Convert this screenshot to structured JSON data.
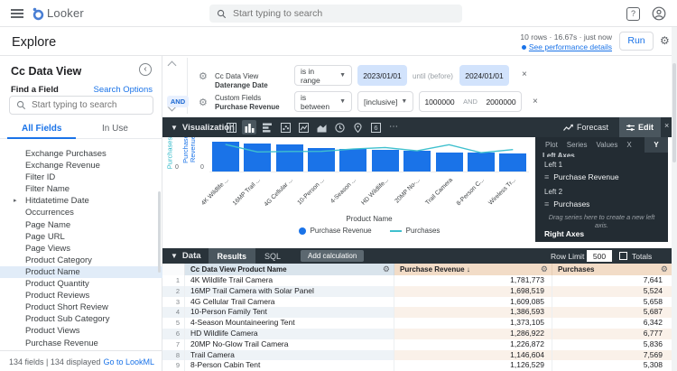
{
  "header": {
    "app_name": "Looker",
    "search_placeholder": "Start typing to search"
  },
  "explore": {
    "title": "Explore",
    "status": "10 rows · 16.67s · just now",
    "perf_link": "See performance details",
    "run_label": "Run"
  },
  "sidebar": {
    "title": "Cc Data View",
    "find_label": "Find a Field",
    "search_options": "Search Options",
    "search_placeholder": "Start typing to search",
    "tabs": [
      "All Fields",
      "In Use"
    ],
    "active_tab": "All Fields",
    "fields": [
      {
        "label": "Exchange Purchases"
      },
      {
        "label": "Exchange Revenue"
      },
      {
        "label": "Filter ID"
      },
      {
        "label": "Filter Name"
      },
      {
        "label": "Hitdatetime Date",
        "expandable": true
      },
      {
        "label": "Occurrences"
      },
      {
        "label": "Page Name"
      },
      {
        "label": "Page URL"
      },
      {
        "label": "Page Views"
      },
      {
        "label": "Product Category"
      },
      {
        "label": "Product Name",
        "selected": true
      },
      {
        "label": "Product Quantity"
      },
      {
        "label": "Product Reviews"
      },
      {
        "label": "Product Short Review"
      },
      {
        "label": "Product Sub Category"
      },
      {
        "label": "Product Views"
      },
      {
        "label": "Purchase Revenue"
      }
    ],
    "footer_text": "134 fields | 134 displayed",
    "footer_link": "Go to LookML"
  },
  "filters": {
    "operator": "AND",
    "rows": [
      {
        "field_group": "Cc Data View",
        "field_name": "Daterange Date",
        "condition": "is in range",
        "value1": "2023/01/01",
        "middle": "until (before)",
        "value2": "2024/01/01"
      },
      {
        "field_group": "Custom Fields",
        "field_name": "Purchase Revenue",
        "condition": "is between",
        "qualifier": "[inclusive]",
        "value1": "1000000",
        "middle": "AND",
        "value2": "2000000"
      }
    ]
  },
  "viz": {
    "section_label": "Visualization",
    "icons": [
      "table",
      "bar",
      "row",
      "scatter",
      "line",
      "area",
      "timeline",
      "map",
      "single-value",
      "more"
    ],
    "active_icon": "bar",
    "forecast_label": "Forecast",
    "edit_label": "Edit",
    "panel_tabs": [
      "Plot",
      "Series",
      "Values",
      "X",
      "Y"
    ],
    "active_panel_tab": "Y",
    "left_axes_label": "Left Axes",
    "left1_label": "Left 1",
    "left1_series": "Purchase Revenue",
    "left2_label": "Left 2",
    "left2_series": "Purchases",
    "drag_hint": "Drag series here to create a new left axis.",
    "right_axes_label": "Right Axes"
  },
  "chart_data": {
    "type": "bar",
    "title": "",
    "xlabel": "Product Name",
    "categories": [
      "4K Wildlife Trail Camera",
      "16MP Trail Camera with Solar Panel",
      "4G Cellular Trail Camera",
      "10-Person Family Tent",
      "4-Season Mountaineering Tent",
      "HD Wildlife Camera",
      "20MP No-Glow Trail Camera",
      "Trail Camera",
      "8-Person Cabin Tent",
      "Wireless Trail Camera"
    ],
    "x_tick_labels": [
      "4K Wildlife ...",
      "16MP Trail ...",
      "4G Cellular ...",
      "10-Person ...",
      "4-Season ...",
      "HD Wildlife...",
      "20MP No-...",
      "Trail Camera",
      "8-Person C...",
      "Wireless Tr..."
    ],
    "series": [
      {
        "name": "Purchase Revenue",
        "type": "bar",
        "axis": "left1",
        "color": "#1a73e8",
        "values": [
          1781773,
          1698519,
          1609085,
          1386593,
          1373105,
          1286922,
          1226872,
          1146604,
          1126529,
          1100000
        ]
      },
      {
        "name": "Purchases",
        "type": "line",
        "axis": "left2",
        "color": "#3fc0ce",
        "values": [
          7641,
          5524,
          5658,
          5687,
          6342,
          6777,
          5836,
          7569,
          5308,
          6200
        ]
      }
    ],
    "y_axes": [
      {
        "label": "Purchase Revenue",
        "color": "#1a73e8",
        "tick": "0"
      },
      {
        "label": "Purchases",
        "color": "#2eb8c9",
        "tick": "0"
      }
    ],
    "legend": [
      "Purchase Revenue",
      "Purchases"
    ],
    "legend_position": "bottom",
    "grid": false
  },
  "data_section": {
    "section_label": "Data",
    "tabs": [
      "Results",
      "SQL"
    ],
    "active_tab": "Results",
    "add_calc_label": "Add calculation",
    "row_limit_label": "Row Limit",
    "row_limit_value": "500",
    "totals_label": "Totals",
    "totals_checked": false
  },
  "table": {
    "columns": [
      {
        "label": "Cc Data View Product Name"
      },
      {
        "label": "Purchase Revenue",
        "sorted": "desc",
        "sort_glyph": "↓"
      },
      {
        "label": "Purchases"
      }
    ],
    "rows": [
      [
        "4K Wildlife Trail Camera",
        "1,781,773",
        "7,641"
      ],
      [
        "16MP Trail Camera with Solar Panel",
        "1,698,519",
        "5,524"
      ],
      [
        "4G Cellular Trail Camera",
        "1,609,085",
        "5,658"
      ],
      [
        "10-Person Family Tent",
        "1,386,593",
        "5,687"
      ],
      [
        "4-Season Mountaineering Tent",
        "1,373,105",
        "6,342"
      ],
      [
        "HD Wildlife Camera",
        "1,286,922",
        "6,777"
      ],
      [
        "20MP No-Glow Trail Camera",
        "1,226,872",
        "5,836"
      ],
      [
        "Trail Camera",
        "1,146,604",
        "7,569"
      ],
      [
        "8-Person Cabin Tent",
        "1,126,529",
        "5,308"
      ]
    ]
  }
}
